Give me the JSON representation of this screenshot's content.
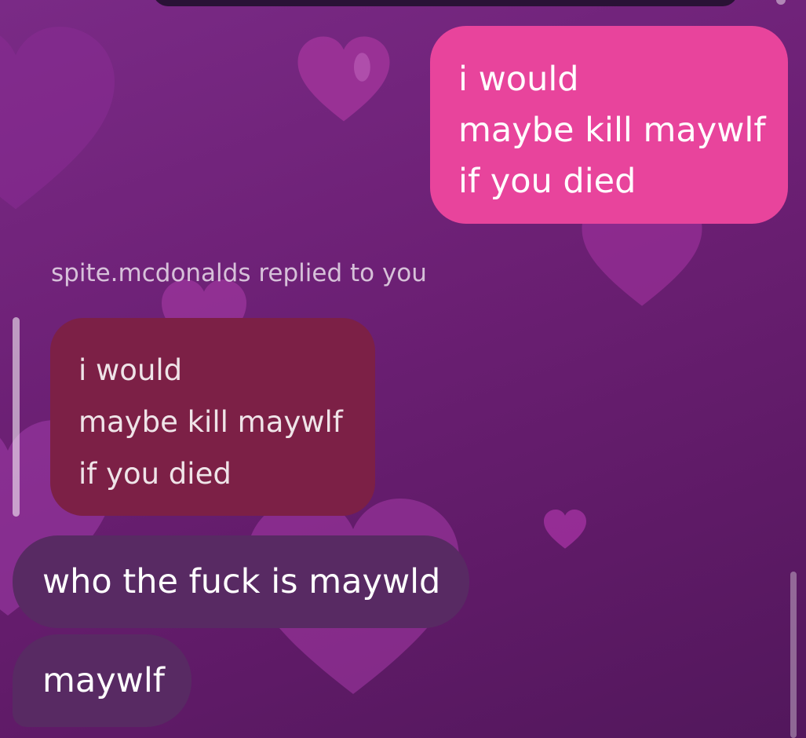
{
  "colors": {
    "background": "#6b1f73",
    "sent_bubble": "#e8449c",
    "quoted_bubble": "#7c2046",
    "received_bubble": "#582a63",
    "text": "#ffffff"
  },
  "background_decoration": {
    "icon": "heart-icon",
    "color": "#b23aa8"
  },
  "sent_message": {
    "lines": [
      "i would",
      "maybe kill maywlf",
      "if you died"
    ]
  },
  "reply_context": {
    "label": "spite.mcdonalds replied to you",
    "quoted_lines": [
      "i would",
      "maybe kill maywlf",
      "if you died"
    ]
  },
  "received_messages": [
    {
      "text": "who the fuck is maywld"
    },
    {
      "text": "maywlf"
    }
  ]
}
